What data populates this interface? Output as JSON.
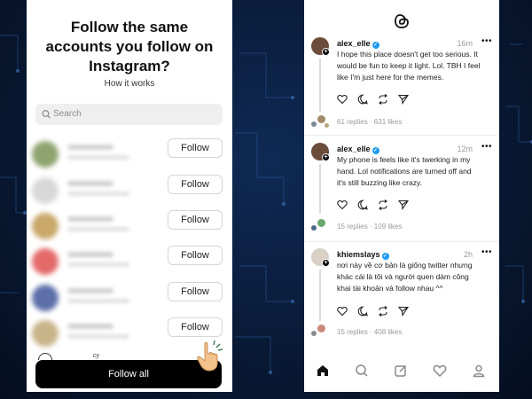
{
  "follow_screen": {
    "title_lines": [
      "Follow the same",
      "accounts you follow on",
      "Instagram?"
    ],
    "how_it_works": "How it works",
    "search_placeholder": "Search",
    "follow_label": "Follow",
    "rows": [
      {
        "avatar_color": "#8fa36e"
      },
      {
        "avatar_color": "#d8d8d8"
      },
      {
        "avatar_color": "#c9a86a"
      },
      {
        "avatar_color": "#e46a6a"
      },
      {
        "avatar_color": "#5c6fa8"
      },
      {
        "avatar_color": "#c9b48a"
      }
    ],
    "partial_row_name": "cy",
    "follow_all_label": "Follow all"
  },
  "threads_feed": {
    "posts": [
      {
        "username": "alex_elle",
        "time": "16m",
        "lines": [
          "I hope this place doesn't get too serious. It",
          "would be fun to keep it light. Lol. TBH I feel",
          "like I'm just here for the memes."
        ],
        "replies_likes": "61 replies · 631 likes",
        "avatar_color": "#6b4b3a"
      },
      {
        "username": "alex_elle",
        "time": "12m",
        "lines": [
          "My phone is feels like it's twerking in my",
          "hand. Lol notifications are turned off and",
          "it's still buzzing like crazy."
        ],
        "replies_likes": "15 replies · 109 likes",
        "avatar_color": "#6b4b3a"
      },
      {
        "username": "khiemslays",
        "time": "2h",
        "lines": [
          "nơi này về cơ bản là giống twitter nhưng",
          "khác cái là tôi và người quen dám công",
          "khai tài khoản và follow nhau ^^"
        ],
        "replies_likes": "15 replies · 408 likes",
        "avatar_color": "#d9d0c7"
      }
    ],
    "more_glyph": "•••",
    "nav_icons": [
      "home-icon",
      "search-icon",
      "compose-icon",
      "heart-icon",
      "profile-icon"
    ]
  }
}
